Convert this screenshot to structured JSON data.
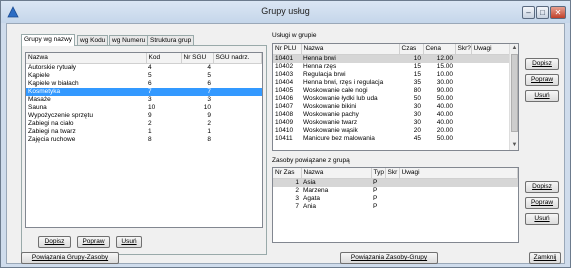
{
  "window": {
    "title": "Grupy usług"
  },
  "colors": {
    "selection": "#3399ff",
    "titlebar": "#cfdcec",
    "close": "#c0402a"
  },
  "tabs": [
    {
      "label": "Grupy wg nazwy",
      "active": true
    },
    {
      "label": "wg Kodu",
      "active": false
    },
    {
      "label": "wg Numeru",
      "active": false
    },
    {
      "label": "Struktura grup",
      "active": false
    }
  ],
  "groups": {
    "columns": [
      "Nazwa",
      "Kod",
      "Nr SGU",
      "SGU nadrz."
    ],
    "rows": [
      [
        "Autorskie rytuały",
        "4",
        "4",
        ""
      ],
      [
        "Kąpiele",
        "5",
        "5",
        ""
      ],
      [
        "Kąpiele w białach",
        "6",
        "6",
        ""
      ],
      [
        "Kosmetyka",
        "7",
        "7",
        ""
      ],
      [
        "Masaże",
        "3",
        "3",
        ""
      ],
      [
        "Sauna",
        "10",
        "10",
        ""
      ],
      [
        "Wypożyczenie sprzętu",
        "9",
        "9",
        ""
      ],
      [
        "Zabiegi na ciało",
        "2",
        "2",
        ""
      ],
      [
        "Zabiegi na twarz",
        "1",
        "1",
        ""
      ],
      [
        "Zajęcia ruchowe",
        "8",
        "8",
        ""
      ]
    ],
    "selected_row": 3,
    "buttons": {
      "add": "Dopisz",
      "edit": "Popraw",
      "delete": "Usuń"
    }
  },
  "services": {
    "label": "Usługi w grupie",
    "columns": [
      "Nr PLU",
      "Nazwa",
      "Czas",
      "Cena",
      "Skr?",
      "Uwagi"
    ],
    "rows": [
      [
        "10401",
        "Henna brwi",
        "10",
        "12.00",
        "",
        ""
      ],
      [
        "10402",
        "Henna rzęs",
        "15",
        "15.00",
        "",
        ""
      ],
      [
        "10403",
        "Regulacja brwi",
        "15",
        "10.00",
        "",
        ""
      ],
      [
        "10404",
        "Henna brwi, rzęs i regulacja",
        "35",
        "30.00",
        "",
        ""
      ],
      [
        "10405",
        "Woskowanie całe nogi",
        "80",
        "90.00",
        "",
        ""
      ],
      [
        "10406",
        "Woskowanie łydki lub uda",
        "50",
        "50.00",
        "",
        ""
      ],
      [
        "10407",
        "Woskowanie bikini",
        "30",
        "40.00",
        "",
        ""
      ],
      [
        "10408",
        "Woskowanie pachy",
        "30",
        "40.00",
        "",
        ""
      ],
      [
        "10409",
        "Woskowanie twarz",
        "30",
        "40.00",
        "",
        ""
      ],
      [
        "10410",
        "Woskowanie wąsik",
        "20",
        "20.00",
        "",
        ""
      ],
      [
        "10411",
        "Manicure bez malowania",
        "45",
        "50.00",
        "",
        ""
      ]
    ],
    "selected_row": 0,
    "buttons": {
      "add": "Dopisz",
      "edit": "Popraw",
      "delete": "Usuń"
    }
  },
  "resources": {
    "label": "Zasoby powiązane z grupą",
    "columns": [
      "Nr Zas",
      "Nazwa",
      "Typ",
      "Skr",
      "Uwagi"
    ],
    "rows": [
      [
        "1",
        "Asia",
        "P",
        "",
        ""
      ],
      [
        "2",
        "Marzena",
        "P",
        "",
        ""
      ],
      [
        "3",
        "Agata",
        "P",
        "",
        ""
      ],
      [
        "7",
        "Ania",
        "P",
        "",
        ""
      ]
    ],
    "selected_row": 0,
    "buttons": {
      "add": "Dopisz",
      "edit": "Popraw",
      "delete": "Usuń"
    }
  },
  "footer": {
    "link_groups_resources": "Powiązania Grupy-Zasoby",
    "link_resources_groups": "Powiązania Zasoby-Grupy",
    "close": "Zamknij"
  }
}
